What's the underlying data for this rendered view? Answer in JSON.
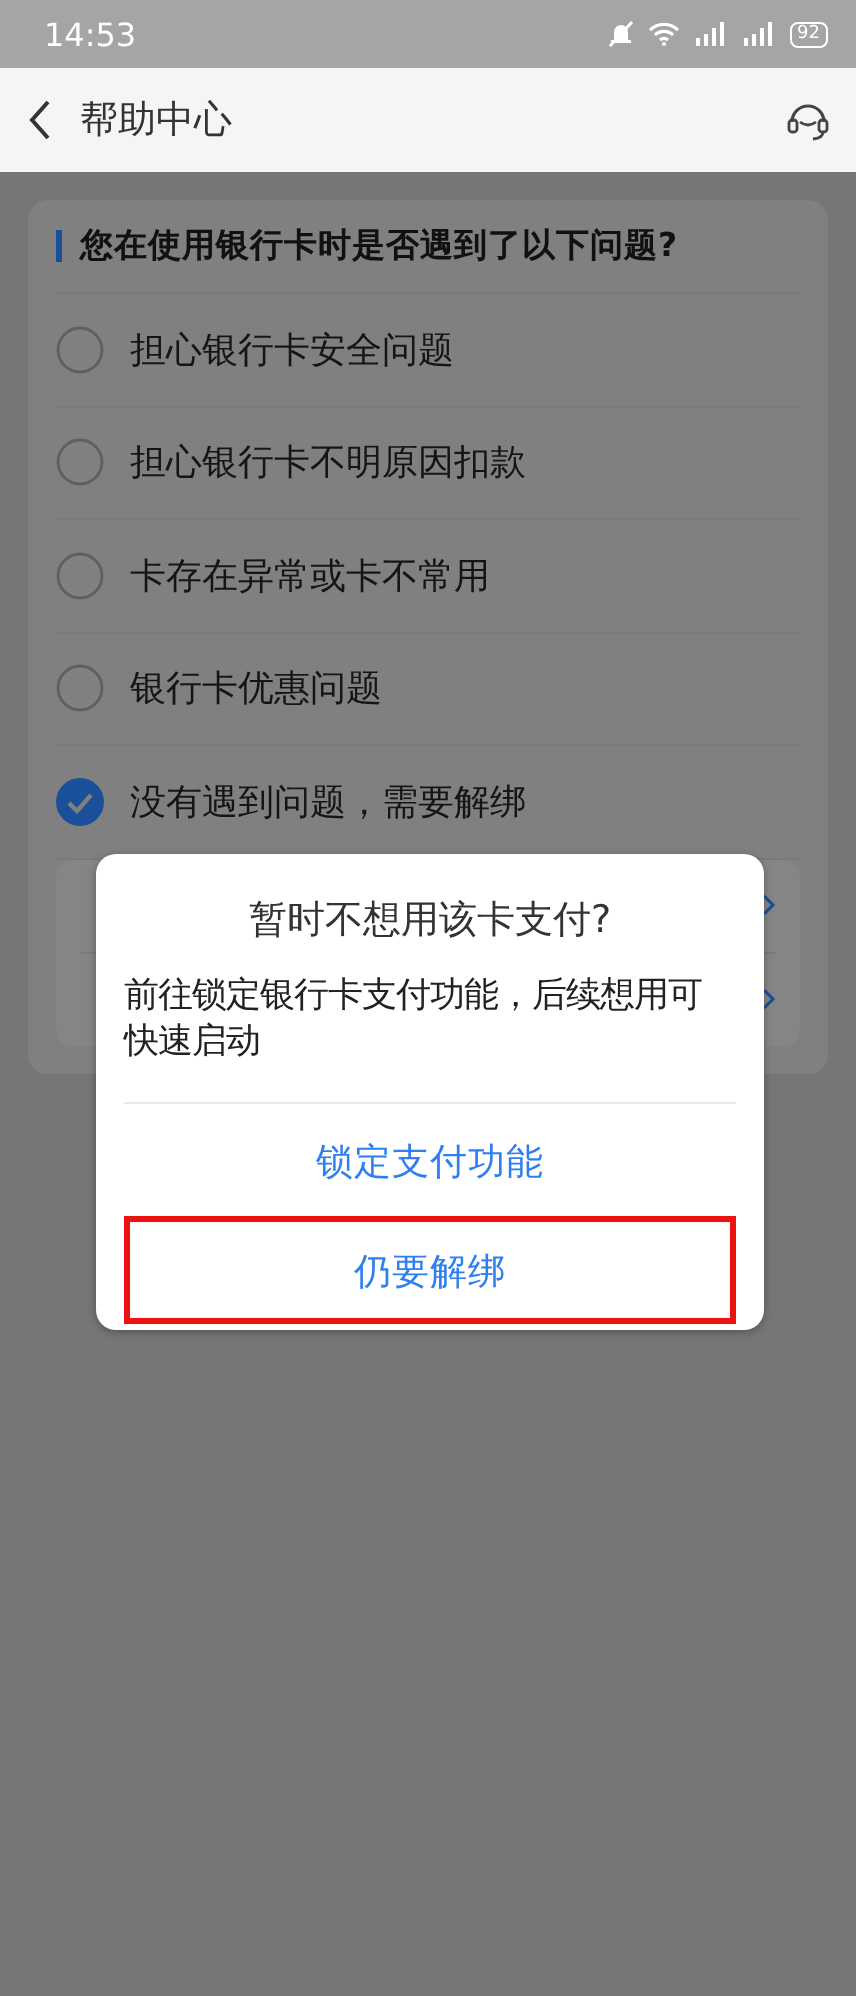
{
  "status_bar": {
    "time": "14:53",
    "battery": "92"
  },
  "header": {
    "title": "帮助中心"
  },
  "question": {
    "title": "您在使用银行卡时是否遇到了以下问题?",
    "options": [
      {
        "label": "担心银行卡安全问题",
        "selected": false
      },
      {
        "label": "担心银行卡不明原因扣款",
        "selected": false
      },
      {
        "label": "卡存在异常或卡不常用",
        "selected": false
      },
      {
        "label": "银行卡优惠问题",
        "selected": false
      },
      {
        "label": "没有遇到问题，需要解绑",
        "selected": true
      }
    ]
  },
  "dialog": {
    "title": "暂时不想用该卡支付?",
    "message": "前往锁定银行卡支付功能，后续想用可快速启动",
    "actions": [
      {
        "label": "锁定支付功能",
        "highlighted": false
      },
      {
        "label": "仍要解绑",
        "highlighted": true
      }
    ]
  }
}
